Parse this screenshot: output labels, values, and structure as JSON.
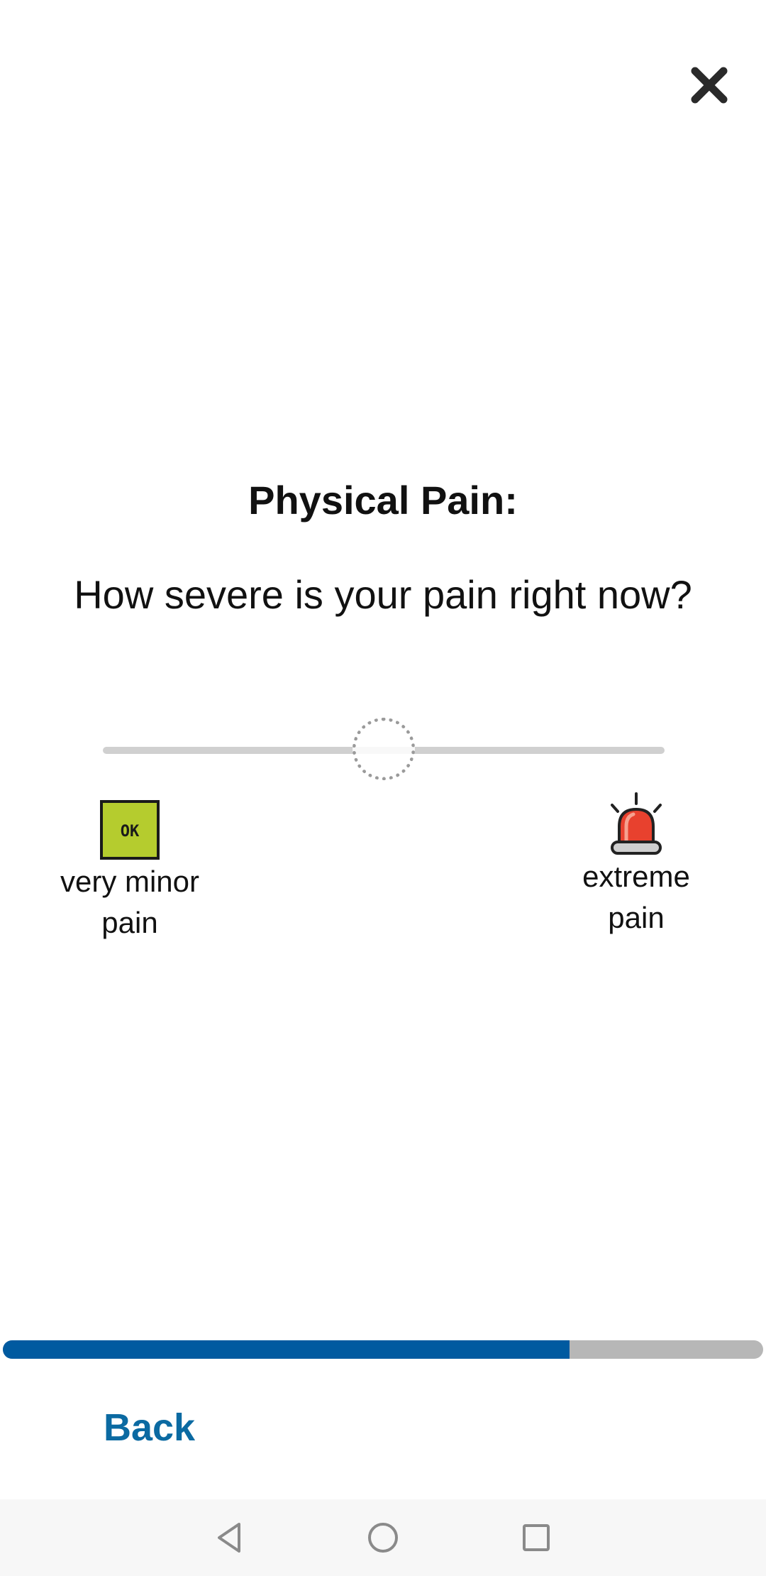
{
  "screen": {
    "title": "Physical Pain:",
    "question": "How severe is your pain right now?"
  },
  "slider": {
    "value_fraction": 0.5,
    "track_color": "#d0d0d0"
  },
  "anchors": {
    "left": {
      "label_line1": "very minor",
      "label_line2": "pain",
      "icon": "ok-square-icon",
      "icon_text": "OK",
      "icon_color": "#b5cc2e"
    },
    "right": {
      "label_line1": "extreme",
      "label_line2": "pain",
      "icon": "siren-alarm-icon",
      "icon_color": "#e8412e"
    }
  },
  "progress": {
    "fraction": 0.745,
    "fill_color": "#005aa0",
    "track_color": "#b7b7b7"
  },
  "footer": {
    "back_label": "Back"
  },
  "icons": {
    "close": "close-icon",
    "nav_back": "triangle-back-icon",
    "nav_home": "circle-home-icon",
    "nav_recents": "square-recents-icon"
  }
}
